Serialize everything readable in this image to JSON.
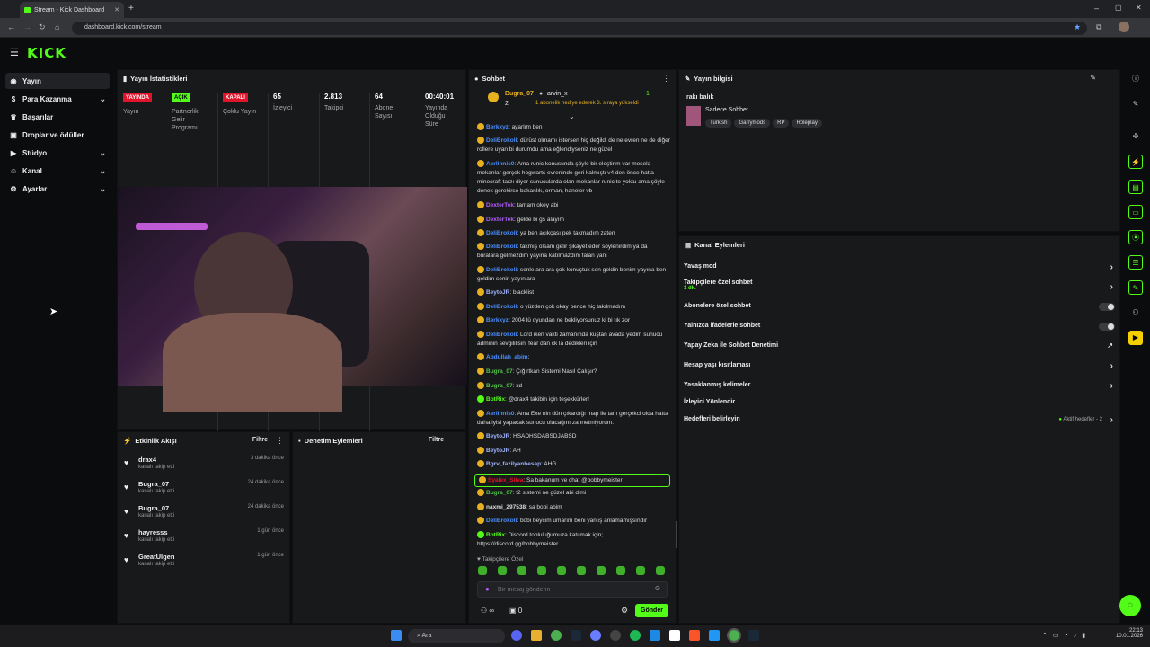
{
  "browser": {
    "tab_title": "Stream - Kick Dashboard",
    "url": "dashboard.kick.com/stream"
  },
  "app": {
    "logo": "KICK"
  },
  "sidebar": {
    "items": [
      {
        "label": "Yayın",
        "icon": "broadcast-icon",
        "active": true
      },
      {
        "label": "Para Kazanma",
        "icon": "dollar-icon",
        "chevron": true
      },
      {
        "label": "Başarılar",
        "icon": "trophy-icon"
      },
      {
        "label": "Droplar ve ödüller",
        "icon": "gift-icon"
      },
      {
        "label": "Stüdyo",
        "icon": "video-icon",
        "chevron": true
      },
      {
        "label": "Kanal",
        "icon": "user-icon",
        "chevron": true
      },
      {
        "label": "Ayarlar",
        "icon": "gear-icon",
        "chevron": true
      }
    ]
  },
  "stats": {
    "title": "Yayın İstatistikleri",
    "items": [
      {
        "badge": "YAYINDA",
        "badge_color": "#e0142b",
        "label": "Yayın"
      },
      {
        "badge": "AÇIK",
        "badge_color": "#53fc18",
        "label": "Partnerlik Gelir Programı"
      },
      {
        "badge": "KAPALI",
        "badge_color": "#e0142b",
        "label": "Çoklu Yayın"
      },
      {
        "value": "65",
        "label": "İzleyici"
      },
      {
        "value": "2.813",
        "label": "Takipçi"
      },
      {
        "value": "64",
        "label": "Abone Sayısı"
      },
      {
        "value": "00:40:01",
        "label": "Yayında Olduğu Süre"
      }
    ]
  },
  "events": {
    "title": "Etkinlik Akışı",
    "filter": "Filtre",
    "items": [
      {
        "name": "drax4",
        "sub": "kanalı takip etti",
        "time": "3 dakika önce"
      },
      {
        "name": "Bugra_07",
        "sub": "kanalı takip etti",
        "time": "24 dakika önce"
      },
      {
        "name": "Bugra_07",
        "sub": "kanalı takip etti",
        "time": "24 dakika önce"
      },
      {
        "name": "hayresss",
        "sub": "kanalı takip etti",
        "time": "1 gün önce"
      },
      {
        "name": "GreatUlgen",
        "sub": "kanalı takip etti",
        "time": "1 gün önce"
      }
    ]
  },
  "mod": {
    "title": "Denetim Eylemleri",
    "filter": "Filtre"
  },
  "chat": {
    "title": "Sohbet",
    "pinned": {
      "user": "Bugra_07",
      "target": "arvin_x",
      "count1": "2",
      "count2": "1",
      "text": "1 abonelik hediye ederek 3. sıraya yükseldi"
    },
    "messages": [
      {
        "user": "Berkxyz",
        "color": "#4a90ff",
        "text": "ayarlım ben"
      },
      {
        "user": "DeliBrokoli",
        "color": "#4a90ff",
        "text": "dürüst olmamı istersen hiç değildi de ne evren ne de diğer rollere uyan bi durumdu ama eğlendiyseniz ne güzel"
      },
      {
        "user": "Aerlinnis0",
        "color": "#4a90ff",
        "text": "Ama runic konusunda şöyle bir eleştirim var mesela mekanlar gerçek hogwarts evreninde geri kalmıştı v4 den önce hatta minecraft tarzı diyer sunucularda olan mekanlar runic te yoktu ama şöyle denek gerekirse bakanlık, orman, haneler vb"
      },
      {
        "user": "DexterTek",
        "color": "#b45cff",
        "text": "tamam okey abi"
      },
      {
        "user": "DexterTek",
        "color": "#b45cff",
        "text": "gelde bi gs alayım"
      },
      {
        "user": "DeliBrokoli",
        "color": "#4a90ff",
        "text": "ya ben açıkçası pek takmadım zaten"
      },
      {
        "user": "DeliBrokoli",
        "color": "#4a90ff",
        "text": "takmış olsam gelir şikayet eder söylenirdim ya da buralara gelmezdim yayına katılmazdım falan yani"
      },
      {
        "user": "DeliBrokoli",
        "color": "#4a90ff",
        "text": "senle ara ara çok konuştuk sen geldin benim yayına ben geldim senin yayınlara"
      },
      {
        "user": "BeytoJR",
        "color": "#9fb4ff",
        "text": "blacklist"
      },
      {
        "user": "DeliBrokoli",
        "color": "#4a90ff",
        "text": "o yüzden çok okay bence hiç takılmadım"
      },
      {
        "user": "Berkxyz",
        "color": "#4a90ff",
        "text": "2004 lü oyundan ne bekliyorsunuz ki bi tık zor"
      },
      {
        "user": "DeliBrokoli",
        "color": "#4a90ff",
        "text": "Lord iken vakti zamanında kuştan avada yedim sunucu adminin sevgililisini fear dan ck la dedikleri için"
      },
      {
        "user": "Abdullah_abim",
        "color": "#4a90ff",
        "text": ""
      },
      {
        "user": "Bugra_07",
        "color": "#53c04b",
        "text": "Çığırtkan Sistemi Nasıl Çalışır?"
      },
      {
        "user": "Bugra_07",
        "color": "#53c04b",
        "text": "xd"
      },
      {
        "user": "BotRix",
        "color": "#53fc18",
        "text": "@drax4 takibin için teşekkürler!"
      },
      {
        "user": "Aerlinnis0",
        "color": "#4a90ff",
        "text": "Ama Exe nin dün çıkardığı map ile tam gerçekci olda hatta daha iyisi yapacak sunucu olacağını zannetmiyorum."
      },
      {
        "user": "BeytoJR",
        "color": "#9fb4ff",
        "text": "HSADHSDABSDJABSD"
      },
      {
        "user": "BeytoJR",
        "color": "#9fb4ff",
        "text": "AH"
      },
      {
        "user": "Bgrv_fazilyanhesap",
        "color": "#9fb4ff",
        "text": "AHG"
      },
      {
        "user": "Syalex_Silva",
        "color": "#e0142b",
        "text": "Sa bakanum ve chat @bobbymeister",
        "highlight": true
      },
      {
        "user": "Bugra_07",
        "color": "#53c04b",
        "text": "f2 sistemi ne güzel abi dimi"
      },
      {
        "user": "naxmi_297538",
        "color": "#dddddd",
        "text": "sa bobi abim"
      },
      {
        "user": "DeliBrokoli",
        "color": "#4a90ff",
        "text": "bobi beycim umarım beni yanlış anlamamışsındır"
      },
      {
        "user": "BotRix",
        "color": "#53fc18",
        "text": "Discord topluluğumuza katılmak için; https://discord.gg/bobbymeister"
      }
    ],
    "followers_only": "Takipçilere Özel",
    "placeholder": "Bir mesaj gönderin",
    "infinity": "∞",
    "count": "0",
    "send": "Gönder"
  },
  "stream_info": {
    "title": "Yayın bilgisi",
    "stream_title": "rakı balık",
    "category": "Sadece Sohbet",
    "tags": [
      "Turkish",
      "Garrymods",
      "RP",
      "Roleplay"
    ]
  },
  "channel_actions": {
    "title": "Kanal Eylemleri",
    "items": [
      {
        "label": "Yavaş mod",
        "control": "arrow"
      },
      {
        "label": "Takipçilere özel sohbet",
        "sub": "1 dk.",
        "control": "arrow"
      },
      {
        "label": "Abonelere özel sohbet",
        "control": "toggle"
      },
      {
        "label": "Yalnızca ifadelerle sohbet",
        "control": "toggle"
      },
      {
        "label": "Yapay Zeka ile Sohbet Denetimi",
        "control": "external"
      },
      {
        "label": "Hesap yaşı kısıtlaması",
        "control": "arrow"
      },
      {
        "label": "Yasaklanmış kelimeler",
        "control": "arrow"
      },
      {
        "label": "İzleyici Yönlendir",
        "control": "none"
      },
      {
        "label": "Hedefleri belirleyin",
        "control": "arrow",
        "extra": "Aktif hedefler - 2"
      }
    ]
  },
  "taskbar": {
    "search": "Ara",
    "time": "22:13",
    "date": "10.01.2026"
  }
}
